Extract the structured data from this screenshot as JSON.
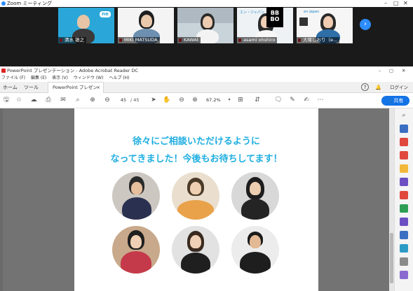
{
  "zoom": {
    "title": "Zoom ミーティング",
    "participants": [
      {
        "name": "清水 雄之"
      },
      {
        "name": "MIKI MATSUDA"
      },
      {
        "name": "KAWAI"
      },
      {
        "name": "asami ohshiro"
      },
      {
        "name": "大塚しおり（e..."
      }
    ],
    "tile1_logo": "ne",
    "tile5_brand": "en-Japan",
    "tile4_brand": "エン・ジャパン",
    "speaker_logo_line1": "BB",
    "speaker_logo_line2": "BO"
  },
  "acrobat": {
    "window_title": "PowerPoint プレゼンテーション - Adobe Acrobat Reader DC",
    "menu": [
      "ファイル (F)",
      "編集 (E)",
      "表示 (V)",
      "ウィンドウ (W)",
      "ヘルプ (H)"
    ],
    "tabs": {
      "home": "ホーム",
      "tools": "ツール",
      "document": "PowerPoint プレゼンテ..."
    },
    "login": "ログイン",
    "page_current": "45",
    "page_total": "/ 45",
    "zoom_level": "67.2%",
    "share_label": "共有"
  },
  "slide": {
    "line1": "徐々にご相談いただけるように",
    "line2": "なってきました！今後もお待ちしてます！"
  },
  "colors": {
    "accent": "#1eaee0",
    "zoom_blue": "#2d8cff",
    "share_blue": "#1473e6"
  }
}
